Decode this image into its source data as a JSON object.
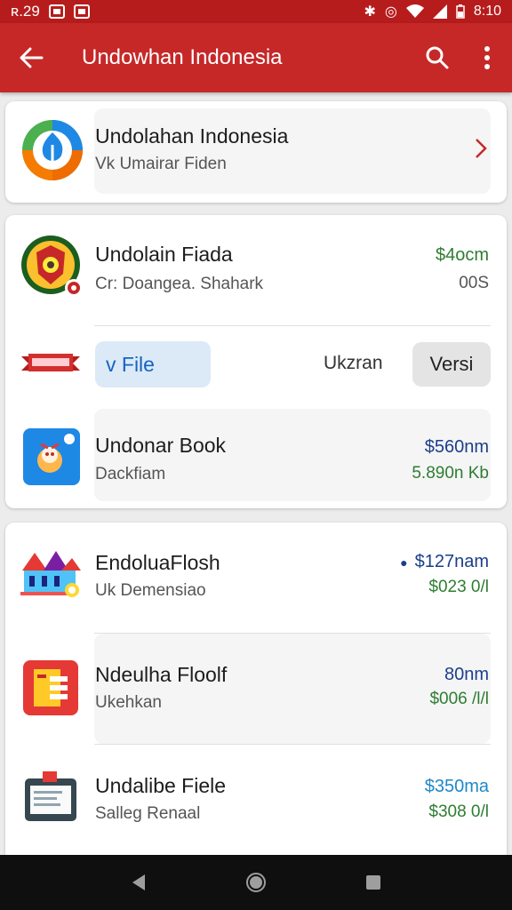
{
  "status_bar": {
    "time_left": "ʀ.29",
    "time_right": "8:10"
  },
  "app_bar": {
    "title": "Undowhan Indonesia",
    "icons": [
      "back-arrow-icon",
      "search-icon",
      "more-vert-icon"
    ]
  },
  "header_card": {
    "title": "Undolahan Indonesia",
    "subtitle": "Vk Umairar Fiden",
    "icon": "leaf-logo-icon"
  },
  "card_two": {
    "item1": {
      "title": "Undolain Fiada",
      "subtitle": "Cr: Doangea. Shahark",
      "price": "$4ocm",
      "meta": "00S",
      "icon": "crest-emblem-icon"
    },
    "actions": {
      "banner_icon": "ribbon-banner-icon",
      "file_button": "v File",
      "label": "Ukzran",
      "version_button": "Versi"
    },
    "item2": {
      "title": "Undonar Book",
      "subtitle": "Dackfiam",
      "price": "$560nm",
      "meta": "5.890n Kb",
      "icon": "book-app-icon"
    }
  },
  "card_three": {
    "items": [
      {
        "title": "EndoluaFlosh",
        "subtitle": "Uk Demensiao",
        "price": "$127nam",
        "meta": "$023 0/l",
        "icon": "castle-building-icon"
      },
      {
        "title": "Ndeulha Floolf",
        "subtitle": "Ukehkan",
        "price": "80nm",
        "meta": "$006 /l/l",
        "icon": "document-app-icon"
      },
      {
        "title": "Undalibe Fiele",
        "subtitle": "Salleg Renaal",
        "price": "$350ma",
        "meta": "$308 0/l",
        "icon": "monitor-app-icon"
      }
    ]
  },
  "colors": {
    "app_bar": "#c62828",
    "status_bar": "#b71c1c",
    "green_text": "#2e7d32",
    "blue_text": "#1a3f8a",
    "nav_bar": "#0f0f0f"
  },
  "nav_bar": {
    "icons": [
      "nav-back-icon",
      "nav-home-icon",
      "nav-recents-icon"
    ]
  }
}
